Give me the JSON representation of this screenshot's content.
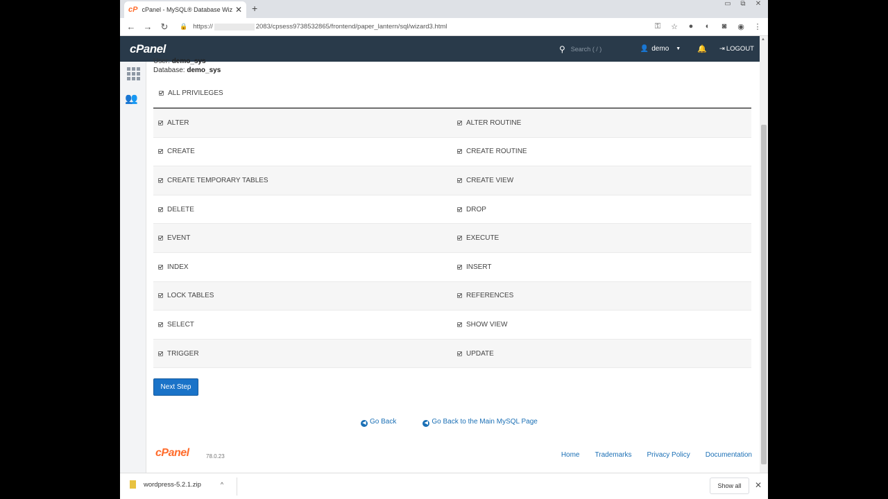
{
  "browser": {
    "tab_title": "cPanel - MySQL® Database Wiz",
    "tab_favicon": "cP",
    "url_prefix": "https://",
    "url_suffix": "2083/cpsess9738532865/frontend/paper_lantern/sql/wizard3.html"
  },
  "header": {
    "logo": "cPanel",
    "search_placeholder": "Search ( / )",
    "user": "demo",
    "logout": "LOGOUT"
  },
  "info": {
    "user_label": "User:",
    "user_value": "demo_sys",
    "db_label": "Database:",
    "db_value": "demo_sys"
  },
  "all_privileges": "ALL PRIVILEGES",
  "privileges": [
    [
      "ALTER",
      "ALTER ROUTINE"
    ],
    [
      "CREATE",
      "CREATE ROUTINE"
    ],
    [
      "CREATE TEMPORARY TABLES",
      "CREATE VIEW"
    ],
    [
      "DELETE",
      "DROP"
    ],
    [
      "EVENT",
      "EXECUTE"
    ],
    [
      "INDEX",
      "INSERT"
    ],
    [
      "LOCK TABLES",
      "REFERENCES"
    ],
    [
      "SELECT",
      "SHOW VIEW"
    ],
    [
      "TRIGGER",
      "UPDATE"
    ]
  ],
  "next_button": "Next Step",
  "links": {
    "go_back": "Go Back",
    "main_mysql": "Go Back to the Main MySQL Page"
  },
  "footer": {
    "logo": "cPanel",
    "version": "78.0.23",
    "links": [
      "Home",
      "Trademarks",
      "Privacy Policy",
      "Documentation"
    ]
  },
  "download": {
    "file": "wordpress-5.2.1.zip",
    "show_all": "Show all"
  }
}
